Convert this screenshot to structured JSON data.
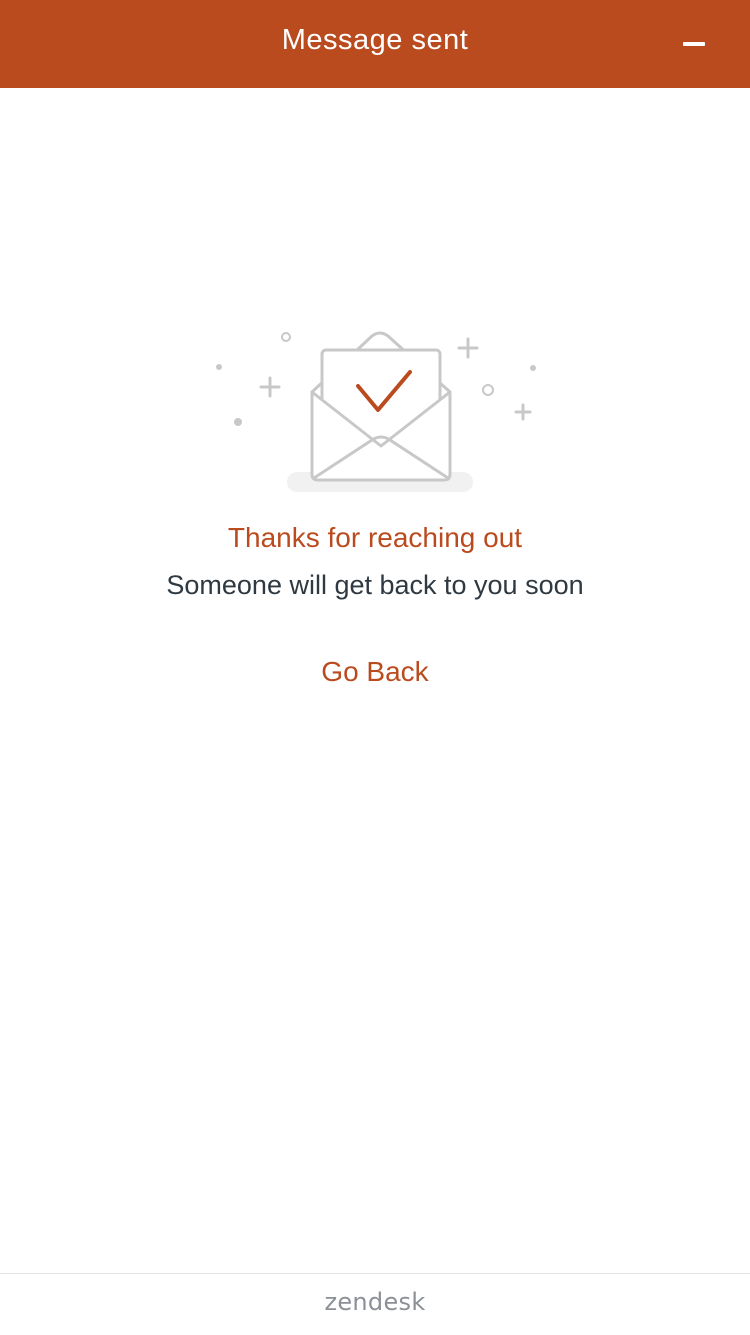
{
  "header": {
    "title": "Message sent",
    "minimize_icon": "minimize-icon",
    "background_color": "#BA4B1F"
  },
  "main": {
    "illustration_icon": "envelope-check-icon",
    "thanks_text": "Thanks for reaching out",
    "subtext": "Someone will get back to you soon",
    "go_back_label": "Go Back",
    "accent_color": "#BA4B1F"
  },
  "footer": {
    "brand": "zendesk"
  }
}
